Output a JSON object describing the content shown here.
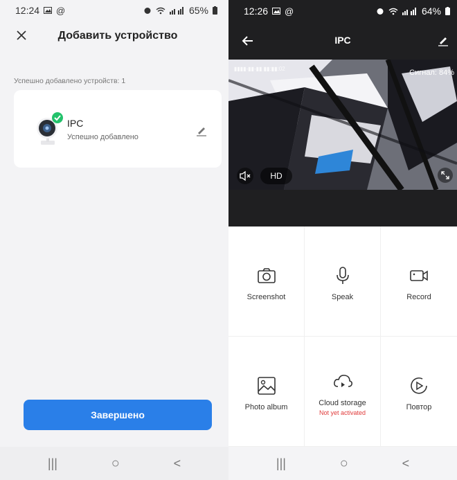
{
  "left": {
    "status": {
      "time": "12:24",
      "battery": "65%"
    },
    "title": "Добавить устройство",
    "added_text": "Успешно добавлено устройств: 1",
    "device": {
      "name": "IPC",
      "status": "Успешно добавлено"
    },
    "done_button": "Завершено",
    "nav": {
      "recent": "|||",
      "home": "○",
      "back": "<"
    }
  },
  "right": {
    "status": {
      "time": "12:26",
      "battery": "64%"
    },
    "title": "IPC",
    "video": {
      "signal": "Сигнал: 84%",
      "hd_label": "HD"
    },
    "actions": [
      {
        "label": "Screenshot",
        "icon": "camera-icon"
      },
      {
        "label": "Speak",
        "icon": "microphone-icon"
      },
      {
        "label": "Record",
        "icon": "video-record-icon"
      },
      {
        "label": "Photo album",
        "icon": "image-icon"
      },
      {
        "label": "Cloud storage",
        "icon": "cloud-play-icon",
        "sub": "Not yet activated"
      },
      {
        "label": "Повтор",
        "icon": "playback-icon"
      }
    ],
    "nav": {
      "recent": "|||",
      "home": "○",
      "back": "<"
    }
  },
  "colors": {
    "accent": "#2a7fe8",
    "success": "#23c26b",
    "warning": "#e03a3a",
    "dark_bar": "#1f1f21"
  }
}
